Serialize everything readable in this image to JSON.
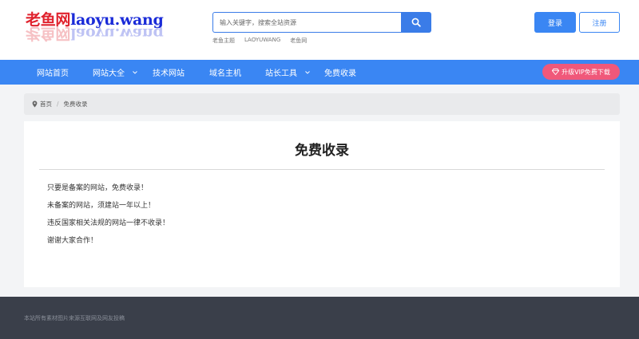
{
  "header": {
    "logo": {
      "text_red": "老鱼网",
      "text_blue": "laoyu.wang"
    },
    "search": {
      "placeholder": "输入关键字，搜索全站资源"
    },
    "hot_words": [
      "老鱼主题",
      "LAOYUWANG",
      "老鱼网"
    ],
    "login_label": "登录",
    "register_label": "注册"
  },
  "nav": {
    "items": [
      {
        "label": "网站首页",
        "dropdown": false
      },
      {
        "label": "网站大全",
        "dropdown": true
      },
      {
        "label": "技术网站",
        "dropdown": false
      },
      {
        "label": "域名主机",
        "dropdown": false
      },
      {
        "label": "站长工具",
        "dropdown": true
      },
      {
        "label": "免费收录",
        "dropdown": false
      }
    ],
    "vip_label": "升级VIP免费下载"
  },
  "breadcrumb": {
    "home": "首页",
    "sep": "/",
    "current": "免费收录"
  },
  "content": {
    "title": "免费收录",
    "paragraphs": [
      "只要是备案的网站，免费收录！",
      "未备案的网站，须建站一年以上！",
      "违反国家相关法规的网站一律不收录！",
      "谢谢大家合作！"
    ]
  },
  "footer": {
    "copyright": "本站所有素材图片来源互联网及网友投稿"
  },
  "colors": {
    "primary": "#3a86f3",
    "vip": "#f0587a",
    "footer": "#3a3f4a",
    "logo_red": "#e0232e",
    "logo_blue": "#1a2bd8"
  }
}
